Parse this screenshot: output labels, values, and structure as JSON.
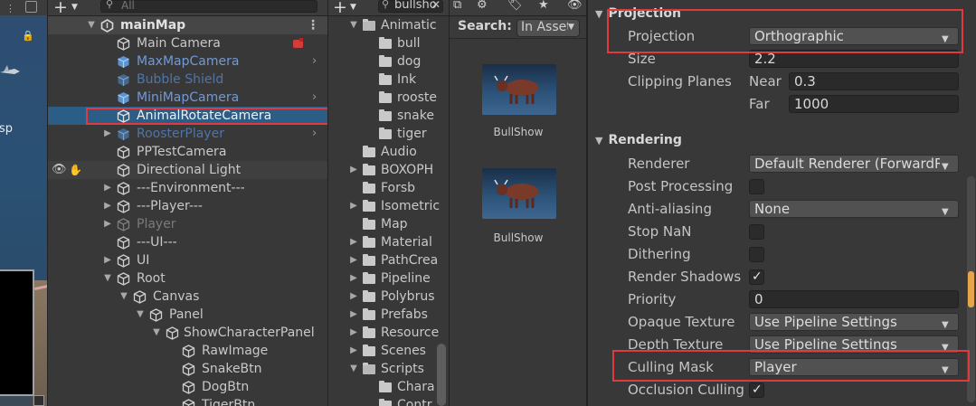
{
  "scene": {
    "partial_label": "sp"
  },
  "hierarchy": {
    "search_placeholder": "All",
    "scene_name": "mainMap",
    "items": [
      {
        "label": "Main Camera"
      },
      {
        "label": "MaxMapCamera"
      },
      {
        "label": "Bubble Shield"
      },
      {
        "label": "MiniMapCamera"
      },
      {
        "label": "AnimalRotateCamera"
      },
      {
        "label": "RoosterPlayer"
      },
      {
        "label": "PPTestCamera"
      },
      {
        "label": "Directional Light"
      },
      {
        "label": "---Environment---"
      },
      {
        "label": "---Player---"
      },
      {
        "label": "Player"
      },
      {
        "label": "---UI---"
      },
      {
        "label": "UI"
      },
      {
        "label": "Root"
      },
      {
        "label": "Canvas"
      },
      {
        "label": "Panel"
      },
      {
        "label": "ShowCharacterPanel"
      },
      {
        "label": "RawImage"
      },
      {
        "label": "SnakeBtn"
      },
      {
        "label": "DogBtn"
      },
      {
        "label": "TigerBtn"
      }
    ]
  },
  "project": {
    "search_value": "bullsho",
    "folders": [
      {
        "label": "Animatic"
      },
      {
        "label": "bull"
      },
      {
        "label": "dog"
      },
      {
        "label": "Ink"
      },
      {
        "label": "rooste"
      },
      {
        "label": "snake"
      },
      {
        "label": "tiger"
      },
      {
        "label": "Audio"
      },
      {
        "label": "BOXOPH"
      },
      {
        "label": "Forsb"
      },
      {
        "label": "Isometric"
      },
      {
        "label": "Map"
      },
      {
        "label": "Material"
      },
      {
        "label": "PathCrea"
      },
      {
        "label": "Pipeline"
      },
      {
        "label": "Polybrus"
      },
      {
        "label": "Prefabs"
      },
      {
        "label": "Resource"
      },
      {
        "label": "Scenes"
      },
      {
        "label": "Scripts"
      },
      {
        "label": "Chara"
      },
      {
        "label": "Contr"
      }
    ]
  },
  "assets": {
    "search_label": "Search:",
    "scope": "In Assets",
    "results": [
      {
        "label": "BullShow"
      },
      {
        "label": "BullShow"
      }
    ]
  },
  "inspector": {
    "projection_header": "Projection",
    "projection": {
      "label": "Projection",
      "value": "Orthographic"
    },
    "size": {
      "label": "Size",
      "value": "2.2"
    },
    "clipping": {
      "label": "Clipping Planes",
      "near_label": "Near",
      "near": "0.3",
      "far_label": "Far",
      "far": "1000"
    },
    "rendering_header": "Rendering",
    "renderer": {
      "label": "Renderer",
      "value": "Default Renderer (ForwardRe"
    },
    "post_processing": {
      "label": "Post Processing",
      "checked": false
    },
    "anti_aliasing": {
      "label": "Anti-aliasing",
      "value": "None"
    },
    "stop_nan": {
      "label": "Stop NaN",
      "checked": false
    },
    "dithering": {
      "label": "Dithering",
      "checked": false
    },
    "render_shadows": {
      "label": "Render Shadows",
      "checked": true
    },
    "priority": {
      "label": "Priority",
      "value": "0"
    },
    "opaque_texture": {
      "label": "Opaque Texture",
      "value": "Use Pipeline Settings"
    },
    "depth_texture": {
      "label": "Depth Texture",
      "value": "Use Pipeline Settings"
    },
    "culling_mask": {
      "label": "Culling Mask",
      "value": "Player"
    },
    "occlusion_culling": {
      "label": "Occlusion Culling",
      "checked": true
    }
  },
  "colors": {
    "selection": "#2c5d87",
    "highlight_box": "#e0393e",
    "prefab_blue": "#6e9ad8"
  }
}
